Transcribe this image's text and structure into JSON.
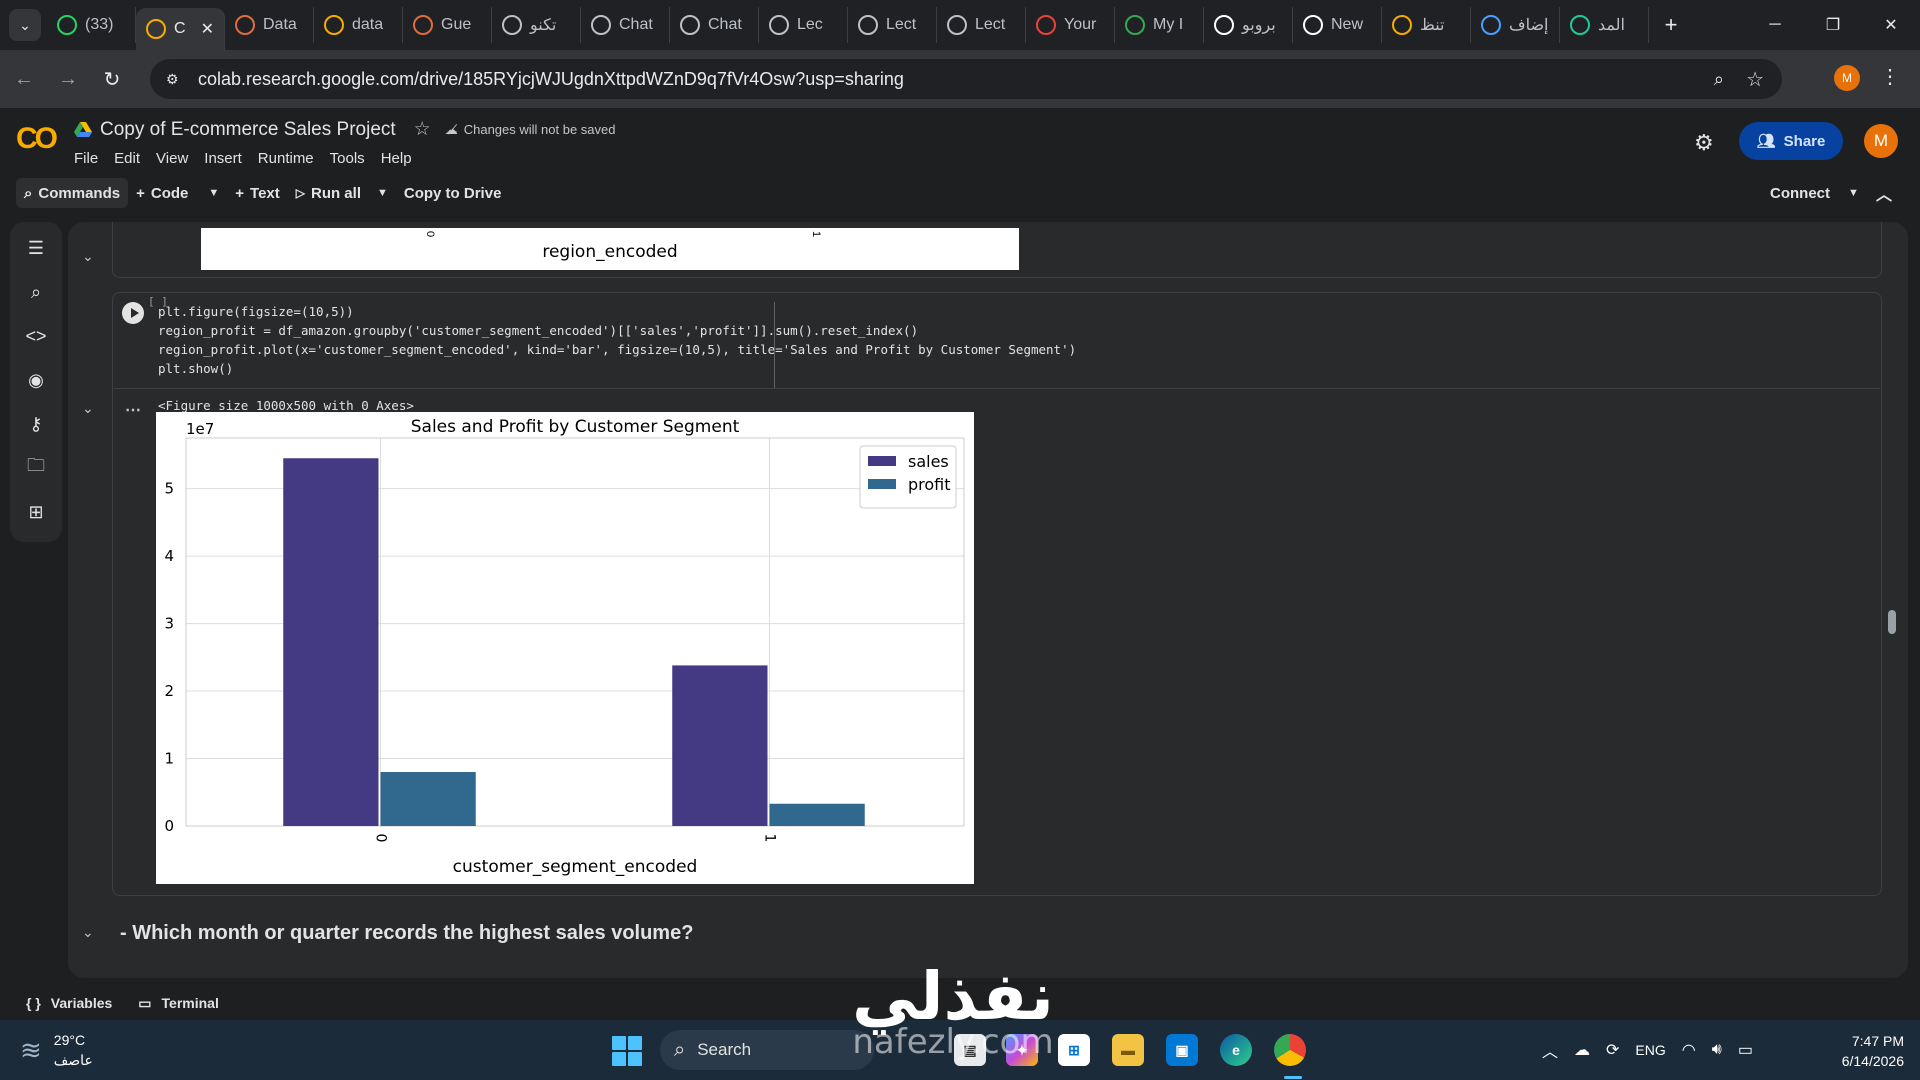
{
  "browser": {
    "tabs": [
      {
        "label": "(33)",
        "icon": "whatsapp-icon",
        "color": "#25d366"
      },
      {
        "label": "C",
        "icon": "colab-icon",
        "color": "#f9ab00",
        "active": true
      },
      {
        "label": "Data",
        "icon": "kaggle-icon",
        "color": "#e06c3c"
      },
      {
        "label": "data",
        "icon": "colab-icon",
        "color": "#f9ab00"
      },
      {
        "label": "Gue",
        "icon": "kaggle-icon",
        "color": "#e06c3c"
      },
      {
        "label": "تكنو",
        "icon": "globe-icon",
        "color": "#bdc1c6"
      },
      {
        "label": "Chat",
        "icon": "globe-icon",
        "color": "#bdc1c6"
      },
      {
        "label": "Chat",
        "icon": "globe-icon",
        "color": "#bdc1c6"
      },
      {
        "label": "Lec",
        "icon": "globe-icon",
        "color": "#bdc1c6"
      },
      {
        "label": "Lect",
        "icon": "globe-icon",
        "color": "#bdc1c6"
      },
      {
        "label": "Lect",
        "icon": "globe-icon",
        "color": "#bdc1c6"
      },
      {
        "label": "Your",
        "icon": "gmail-icon",
        "color": "#ea4335"
      },
      {
        "label": "My I",
        "icon": "drive-icon",
        "color": "#34a853"
      },
      {
        "label": "بروبو",
        "icon": "openai-icon",
        "color": "#ffffff"
      },
      {
        "label": "New",
        "icon": "chatgpt-icon",
        "color": "#ffffff"
      },
      {
        "label": "تنظ",
        "icon": "number-5-icon",
        "color": "#f9ab00"
      },
      {
        "label": "إضاف",
        "icon": "edge-icon",
        "color": "#4a9eff"
      },
      {
        "label": "المد",
        "icon": "k-icon",
        "color": "#20c997"
      }
    ],
    "close_glyph": "✕",
    "new_tab_glyph": "+",
    "url": "colab.research.google.com/drive/185RYjcjWJUgdnXttpdWZnD9q7fVr4Osw?usp=sharing",
    "profile_initial": "M"
  },
  "colab": {
    "logo": "CO",
    "title": "Copy of E-commerce Sales Project",
    "unsaved_note": "Changes will not be saved",
    "menu": [
      "File",
      "Edit",
      "View",
      "Insert",
      "Runtime",
      "Tools",
      "Help"
    ],
    "share_label": "Share",
    "user_initial": "M",
    "toolbar": {
      "commands": "Commands",
      "code": "Code",
      "text": "Text",
      "run_all": "Run all",
      "copy_to_drive": "Copy to Drive",
      "connect": "Connect"
    }
  },
  "notebook": {
    "prev_output": {
      "xlabel": "region_encoded",
      "ticks": [
        "0",
        "1"
      ]
    },
    "cell": {
      "exec_count": "[ ]",
      "code_lines": [
        "plt.figure(figsize=(10,5))",
        "region_profit = df_amazon.groupby('customer_segment_encoded')[['sales','profit']].sum().reset_index()",
        "region_profit.plot(x='customer_segment_encoded', kind='bar', figsize=(10,5), title='Sales and Profit by Customer Segment')",
        "plt.show()"
      ],
      "output_text": "<Figure size 1000x500 with 0 Axes>"
    },
    "markdown_heading": "- Which month or quarter records the highest sales volume?"
  },
  "chart_data": {
    "type": "bar",
    "title": "Sales and Profit by Customer Segment",
    "xlabel": "customer_segment_encoded",
    "ylabel": "",
    "scale_label": "1e7",
    "categories": [
      "0",
      "1"
    ],
    "series": [
      {
        "name": "sales",
        "values": [
          5.45,
          2.38
        ],
        "color": "#443983"
      },
      {
        "name": "profit",
        "values": [
          0.8,
          0.33
        ],
        "color": "#31688e"
      }
    ],
    "ylim": [
      0,
      5.75
    ],
    "yticks": [
      0,
      1,
      2,
      3,
      4,
      5
    ],
    "grid": true,
    "legend": "top-right"
  },
  "statusbar": {
    "variables": "Variables",
    "terminal": "Terminal"
  },
  "taskbar": {
    "temperature": "29°C",
    "weather_desc": "عاصف",
    "search_label": "Search",
    "language": "ENG",
    "time": "7:47 PM",
    "date": "6/14/2026"
  },
  "watermark": {
    "arabic": "نفذلي",
    "latin": "nafezly.com"
  }
}
